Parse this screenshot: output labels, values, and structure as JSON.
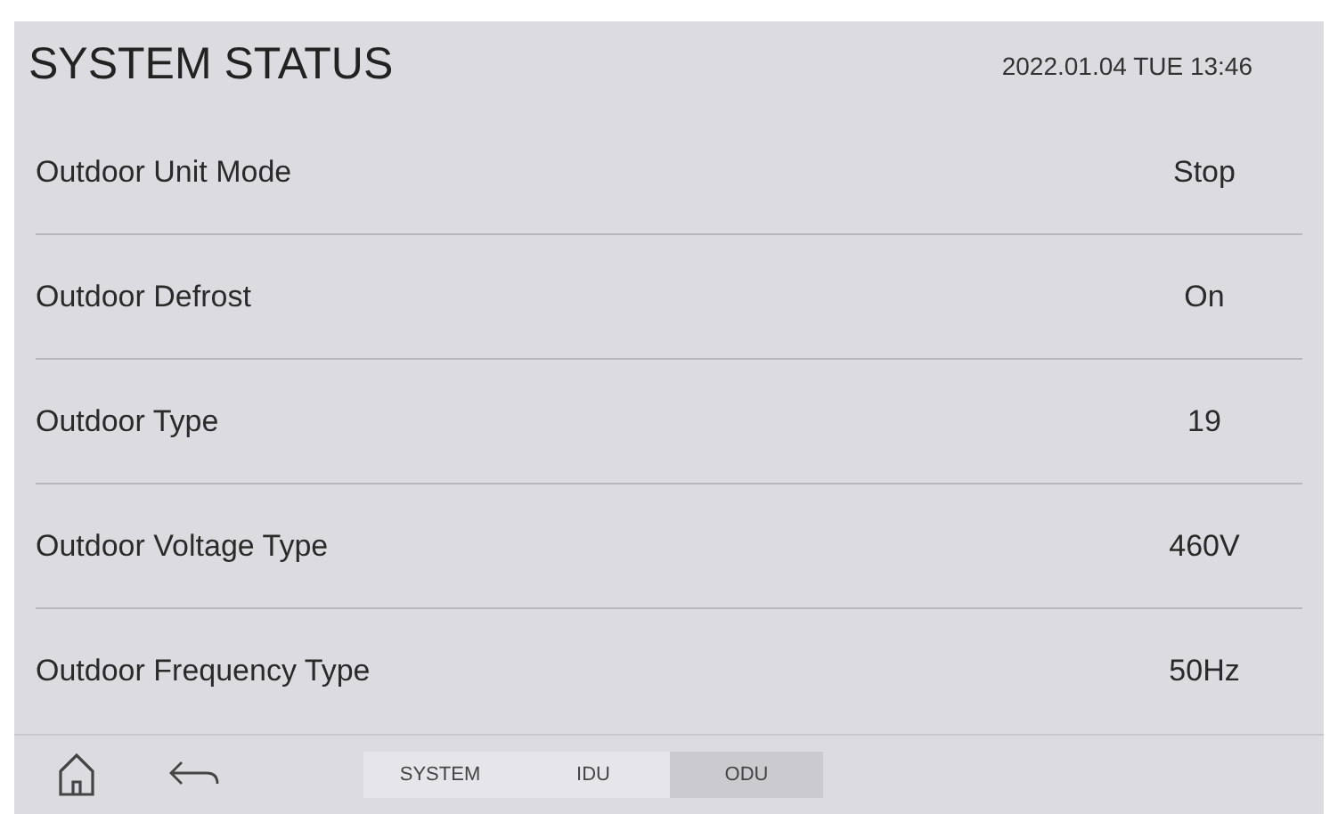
{
  "header": {
    "title": "SYSTEM STATUS",
    "datetime": "2022.01.04 TUE 13:46"
  },
  "rows": [
    {
      "label": "Outdoor Unit Mode",
      "value": "Stop"
    },
    {
      "label": "Outdoor Defrost",
      "value": "On"
    },
    {
      "label": "Outdoor Type",
      "value": "19"
    },
    {
      "label": "Outdoor Voltage Type",
      "value": "460V"
    },
    {
      "label": "Outdoor Frequency Type",
      "value": "50Hz"
    }
  ],
  "tabs": [
    {
      "label": "SYSTEM",
      "selected": false
    },
    {
      "label": "IDU",
      "selected": false
    },
    {
      "label": "ODU",
      "selected": true
    }
  ]
}
